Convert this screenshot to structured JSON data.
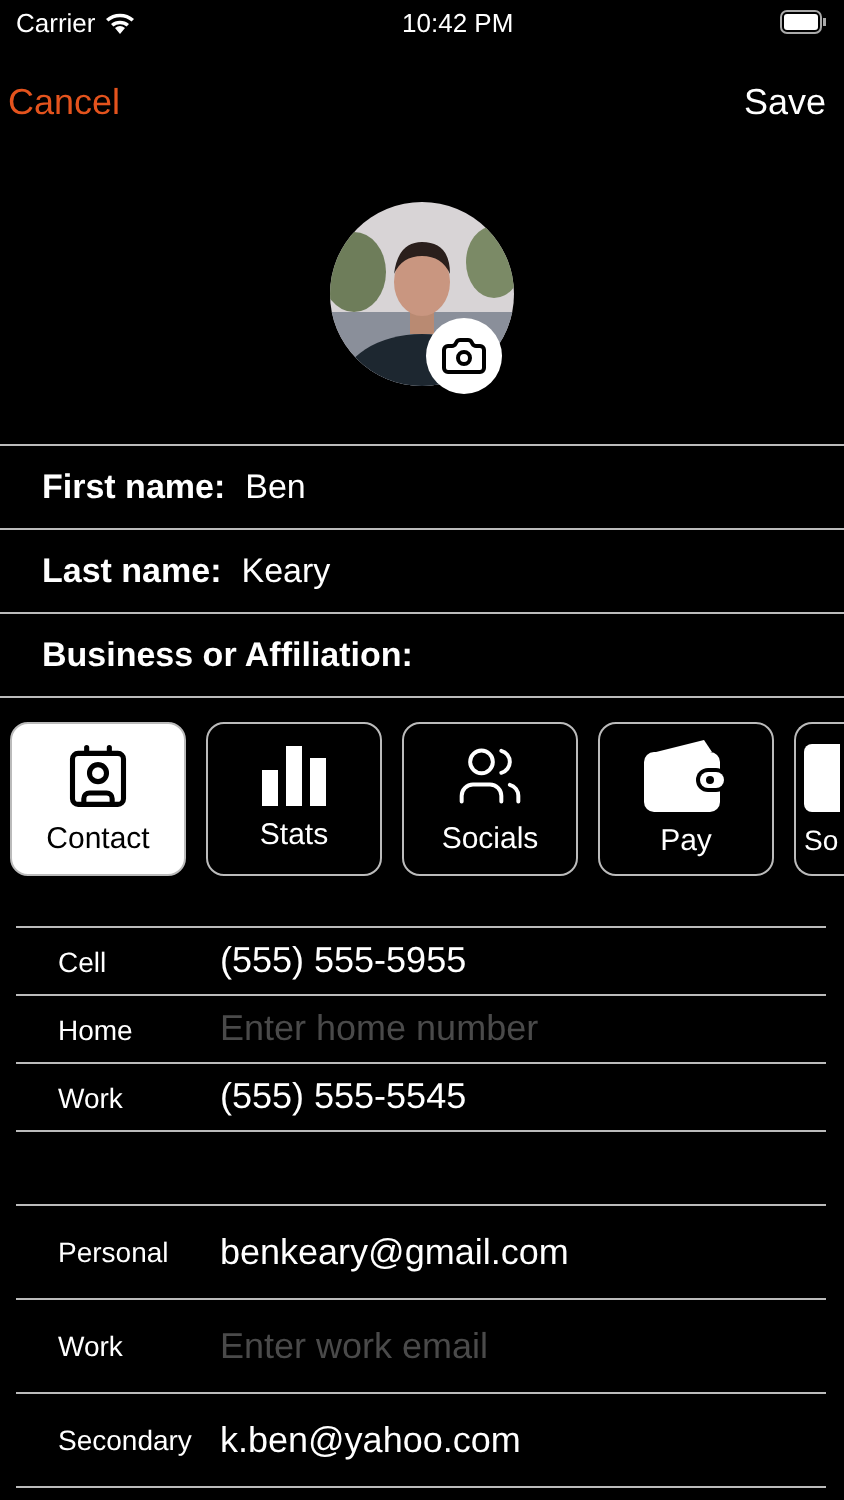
{
  "status_bar": {
    "carrier": "Carrier",
    "time": "10:42 PM"
  },
  "nav": {
    "cancel": "Cancel",
    "save": "Save"
  },
  "name_fields": [
    {
      "label": "First name:",
      "value": "Ben"
    },
    {
      "label": "Last name:",
      "value": "Keary"
    },
    {
      "label": "Business or Affiliation:"
    }
  ],
  "tabs": [
    {
      "label": "Contact",
      "selected": true,
      "kind": "full"
    },
    {
      "label": "Stats",
      "selected": false,
      "kind": "full"
    },
    {
      "label": "Socials",
      "selected": false,
      "kind": "full"
    },
    {
      "label": "Pay",
      "selected": false,
      "kind": "full"
    },
    {
      "label": "So",
      "selected": false,
      "kind": "partial"
    }
  ],
  "phone_fields": [
    {
      "label": "Cell",
      "value": "(555) 555-5955"
    },
    {
      "label": "Home",
      "placeholder": "Enter home number"
    },
    {
      "label": "Work",
      "value": "(555) 555-5545"
    }
  ],
  "email_fields": [
    {
      "label": "Personal",
      "value": "benkeary@gmail.com"
    },
    {
      "label": "Work",
      "placeholder": "Enter work email"
    },
    {
      "label": "Secondary",
      "value": "k.ben@yahoo.com"
    }
  ]
}
